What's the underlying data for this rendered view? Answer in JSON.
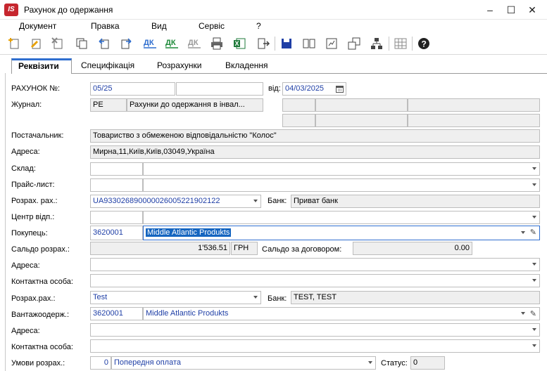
{
  "window": {
    "logo_text": "IS",
    "title": "Рахунок до одержання",
    "minimize": "–",
    "maximize": "☐",
    "close": "✕"
  },
  "menu": [
    "Документ",
    "Правка",
    "Вид",
    "Сервіс",
    "?"
  ],
  "toolbar_icons": [
    "add-doc-icon",
    "edit-doc-icon",
    "delete-doc-icon",
    "copy-icon",
    "move-left-icon",
    "move-right-icon",
    "dk-icon",
    "dk-green-icon",
    "dk-gray-icon",
    "print-icon",
    "excel-icon",
    "exit-icon",
    "save-icon",
    "book-icon",
    "report-icon",
    "export-icon",
    "tree-icon",
    "grid-icon",
    "help-icon"
  ],
  "tabs": [
    "Реквізити",
    "Специфікація",
    "Розрахунки",
    "Вкладення"
  ],
  "labels": {
    "invoice_no": "РАХУНОК №:",
    "from": "від:",
    "journal": "Журнал:",
    "supplier": "Постачальник:",
    "address": "Адреса:",
    "warehouse": "Склад:",
    "price_list": "Прайс-лист:",
    "account": "Розрах. рах.:",
    "bank": "Банк:",
    "cost_center": "Центр відп.:",
    "buyer": "Покупець:",
    "balance": "Сальдо розрах.:",
    "balance_contract": "Сальдо за договором:",
    "address2": "Адреса:",
    "contact": "Контактна особа:",
    "account2": "Розрах.рах.:",
    "bank2": "Банк:",
    "consignee": "Вантажоодерж.:",
    "address3": "Адреса:",
    "contact2": "Контактна особа:",
    "terms": "Умови розрах.:",
    "status": "Статус:"
  },
  "values": {
    "invoice_no": "05/25",
    "date": "04/03/2025",
    "journal_code": "РЕ",
    "journal_name": "Рахунки до одержання в інвал...",
    "supplier": "Товариство з обмеженою відповідальністю \"Колос\"",
    "address": "Мирна,11,Київ,Київ,03049,Україна",
    "account": "UA933026890000026005221902122",
    "bank": "Приват банк",
    "buyer_code": "3620001",
    "buyer_name": "Middle Atlantic Produkts",
    "balance": "1'536.51",
    "currency": "ГРН",
    "balance_contract": "0.00",
    "account2": "Test",
    "bank2": "TEST, TEST",
    "consignee_code": "3620001",
    "consignee_name": "Middle Atlantic Produkts",
    "terms_code": "0",
    "terms_name": "Попередня оплата",
    "status": "0"
  }
}
